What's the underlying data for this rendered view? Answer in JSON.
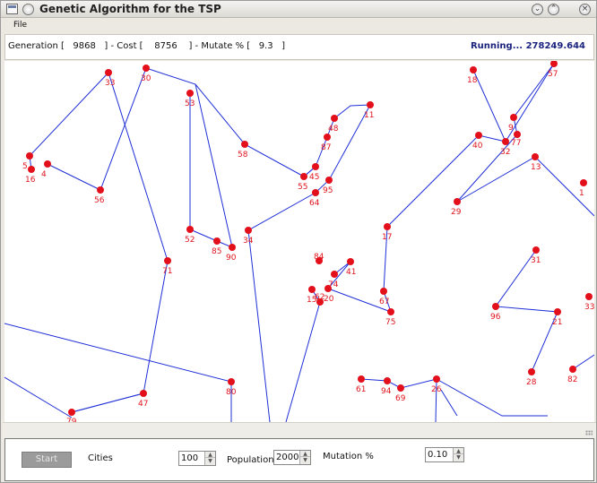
{
  "window": {
    "title": "Genetic Algorithm for the TSP"
  },
  "menu": {
    "file": "File"
  },
  "status": {
    "left_text": "Generation [   9868   ] - Cost [    8756    ] - Mutate % [   9.3   ]",
    "running": "Running... 278249.644"
  },
  "controls": {
    "start_label": "Start",
    "cities_label": "Cities",
    "cities_value": "100",
    "population_label": "Population",
    "population_value": "2000",
    "mutation_label": "Mutation %",
    "mutation_value": "0.10"
  },
  "colors": {
    "route_line": "#1f2fd6",
    "city_dot": "#e3101c",
    "city_label": "#e0141e",
    "status_running": "#1a237e"
  },
  "icons": {
    "window_menu": "window-menu-icon",
    "title_button": "circle-icon",
    "minimize": "chevron-down-icon",
    "restore": "chevron-up-icon",
    "close": "close-icon"
  },
  "cities": [
    {
      "label": "33"
    },
    {
      "label": "30"
    },
    {
      "label": "53"
    },
    {
      "label": "58"
    },
    {
      "label": "5"
    },
    {
      "label": "4"
    },
    {
      "label": "16"
    },
    {
      "label": "56"
    },
    {
      "label": "52"
    },
    {
      "label": "85"
    },
    {
      "label": "90"
    },
    {
      "label": "34"
    },
    {
      "label": "71"
    },
    {
      "label": "80"
    },
    {
      "label": "47"
    },
    {
      "label": "79"
    },
    {
      "label": "84"
    },
    {
      "label": "11"
    },
    {
      "label": "48"
    },
    {
      "label": "87"
    },
    {
      "label": "45"
    },
    {
      "label": "55"
    },
    {
      "label": "95"
    },
    {
      "label": "64"
    },
    {
      "label": "18"
    },
    {
      "label": "57"
    },
    {
      "label": "9"
    },
    {
      "label": "40"
    },
    {
      "label": "77"
    },
    {
      "label": "32"
    },
    {
      "label": "13"
    },
    {
      "label": "29"
    },
    {
      "label": "1"
    },
    {
      "label": "17"
    },
    {
      "label": "67"
    },
    {
      "label": "75"
    },
    {
      "label": "74"
    },
    {
      "label": "41"
    },
    {
      "label": "15"
    },
    {
      "label": "20"
    },
    {
      "label": "62"
    },
    {
      "label": "31"
    },
    {
      "label": "96"
    },
    {
      "label": "21"
    },
    {
      "label": "33"
    },
    {
      "label": "28"
    },
    {
      "label": "82"
    },
    {
      "label": "61"
    },
    {
      "label": "94"
    },
    {
      "label": "69"
    },
    {
      "label": "26"
    }
  ]
}
